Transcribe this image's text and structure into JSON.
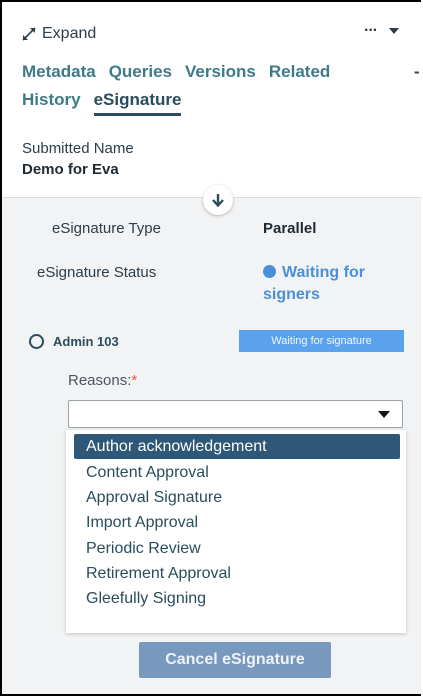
{
  "header": {
    "expand_label": "Expand",
    "more_label": "···"
  },
  "tabs": [
    {
      "label": "Metadata"
    },
    {
      "label": "Queries"
    },
    {
      "label": "Versions"
    },
    {
      "label": "Related"
    },
    {
      "label": "History"
    },
    {
      "label": "eSignature",
      "active": true
    }
  ],
  "tabs_overflow": "-",
  "submitted": {
    "label": "Submitted Name",
    "value": "Demo for Eva"
  },
  "esignature": {
    "type_label": "eSignature Type",
    "type_value": "Parallel",
    "status_label": "eSignature Status",
    "status_value": "Waiting for signers",
    "status_color": "#4a90d9"
  },
  "signer": {
    "name": "Admin 103",
    "status_badge": "Waiting for signature",
    "badge_color": "#5aa2ec"
  },
  "reasons": {
    "label": "Reasons:",
    "required_mark": "*",
    "selected_value": "",
    "options": [
      "Author acknowledgement",
      "Content Approval",
      "Approval Signature",
      "Import Approval",
      "Periodic Review",
      "Retirement Approval",
      "Gleefully Signing"
    ],
    "highlighted_index": 0
  },
  "actions": {
    "cancel_label": "Cancel eSignature"
  },
  "colors": {
    "accent": "#2a4d5c",
    "tab_text": "#3f7a8a",
    "highlight": "#2f5878",
    "cancel_button": "#7898bd"
  }
}
